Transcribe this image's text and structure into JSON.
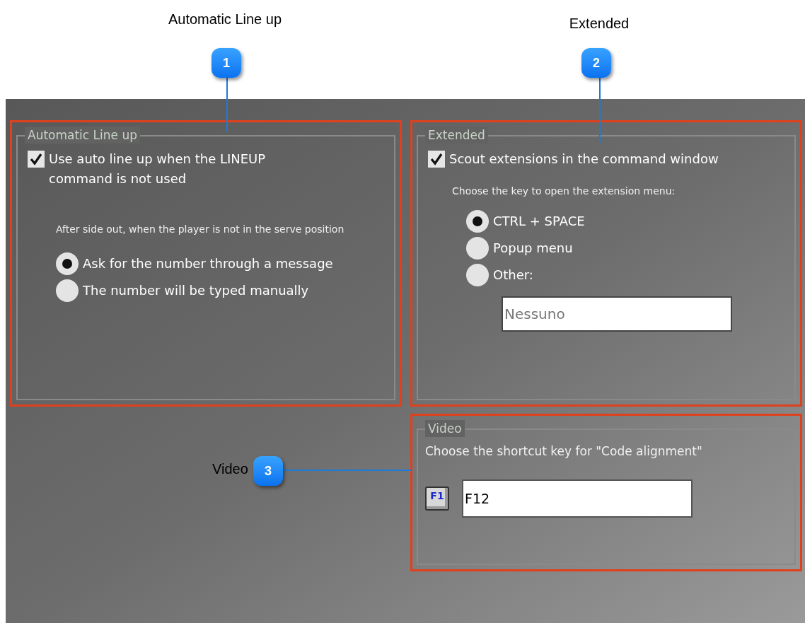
{
  "callouts": [
    {
      "number": "1",
      "label": "Automatic Line up"
    },
    {
      "number": "2",
      "label": "Extended"
    },
    {
      "number": "3",
      "label": "Video"
    }
  ],
  "groups": [
    {
      "kind": "options",
      "title": "Automatic Line up",
      "checkbox": {
        "label": "Use auto line up when the LINEUP command is not used",
        "checked": true
      },
      "prompt": "After side out, when the player is not in the serve position",
      "options": [
        {
          "label": "Ask for the number through a message",
          "selected": true
        },
        {
          "label": "The number will be typed manually",
          "selected": false
        }
      ]
    },
    {
      "kind": "options",
      "title": "Extended",
      "checkbox": {
        "label": "Scout extensions in the command window",
        "checked": true
      },
      "prompt": "Choose the key to open the extension menu:",
      "options": [
        {
          "label": "CTRL + SPACE",
          "selected": true
        },
        {
          "label": "Popup menu",
          "selected": false
        },
        {
          "label": "Other:",
          "selected": false
        }
      ],
      "field": {
        "value": "Nessuno"
      }
    },
    {
      "kind": "shortcut",
      "title": "Video",
      "prompt": "Choose the shortcut key for \"Code alignment\"",
      "key_icon": "F1",
      "field": {
        "value": "F12"
      }
    }
  ]
}
